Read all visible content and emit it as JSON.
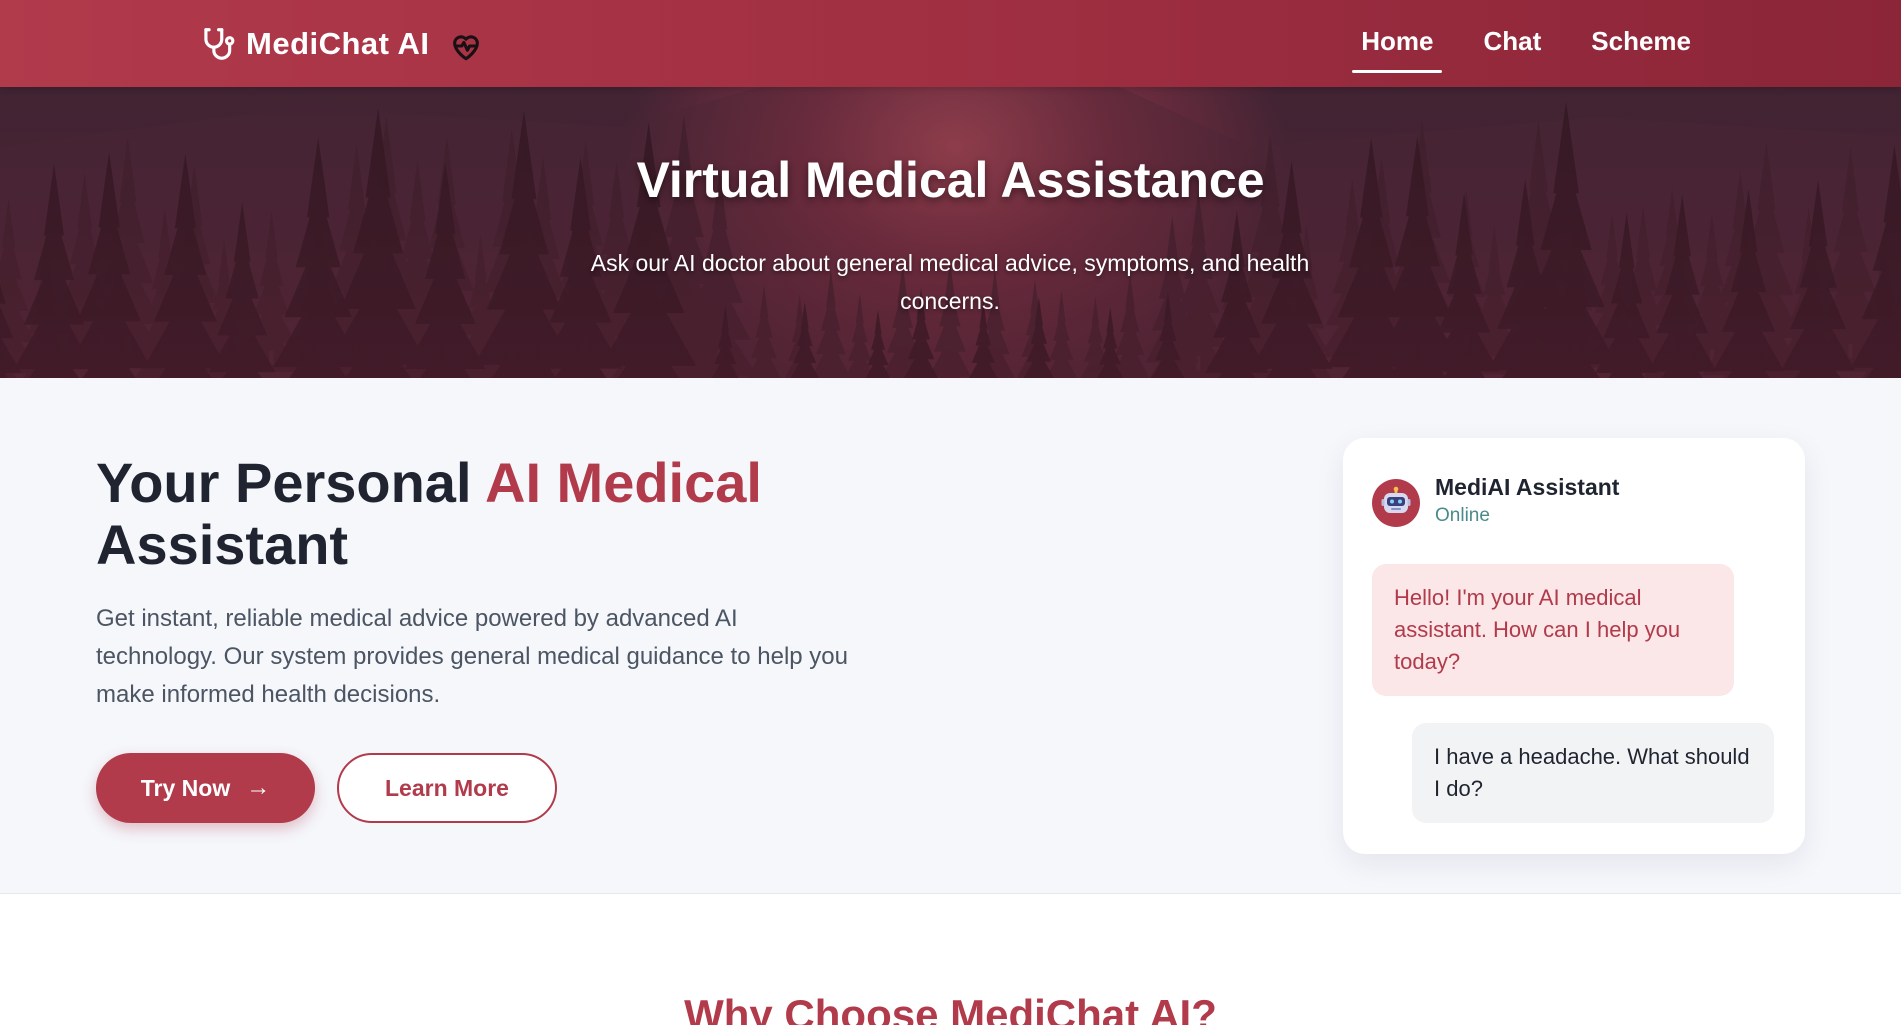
{
  "navbar": {
    "brand": "MediChat AI",
    "links": [
      {
        "label": "Home",
        "active": true
      },
      {
        "label": "Chat",
        "active": false
      },
      {
        "label": "Scheme",
        "active": false
      }
    ]
  },
  "hero": {
    "title": "Virtual Medical Assistance",
    "subtitle": "Ask our AI doctor about general medical advice, symptoms, and health concerns."
  },
  "intro": {
    "title_part1": "Your Personal ",
    "title_accent": "AI Medical",
    "title_part2": "Assistant",
    "description": "Get instant, reliable medical advice powered by advanced AI technology. Our system provides general medical guidance to help you make informed health decisions.",
    "primary_button": "Try Now",
    "primary_button_arrow": "→",
    "secondary_button": "Learn More"
  },
  "chat_preview": {
    "assistant_name": "MediAI Assistant",
    "status": "Online",
    "messages": [
      {
        "from": "assistant",
        "text": "Hello! I'm your AI medical assistant. How can I help you today?"
      },
      {
        "from": "user",
        "text": "I have a headache. What should I do?"
      }
    ]
  },
  "why_section": {
    "title": "Why Choose MediChat AI?"
  },
  "colors": {
    "brand": "#b13a4b",
    "nav_gradient_end": "#8b2538",
    "ai_bubble_bg": "#fbe6e8",
    "user_bubble_bg": "#f2f3f5",
    "status_online": "#4a8a8a"
  },
  "icons": {
    "brand_logo": "stethoscope-icon",
    "brand_badge": "heart-pulse-icon",
    "avatar": "robot-icon",
    "button_arrow": "arrow-right-icon"
  }
}
